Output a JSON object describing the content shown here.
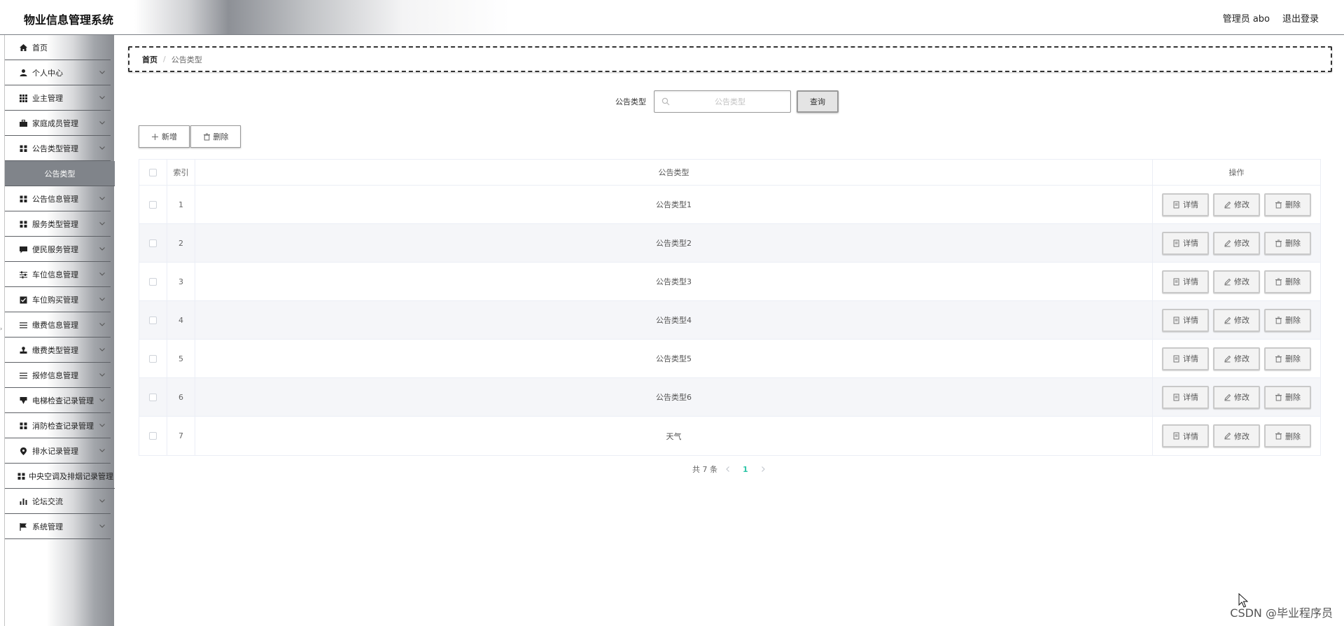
{
  "header": {
    "title": "物业信息管理系统",
    "user": "管理员 abo",
    "logout": "退出登录"
  },
  "sidebar": {
    "items": [
      {
        "label": "首页",
        "icon": "home-icon",
        "expandable": false
      },
      {
        "label": "个人中心",
        "icon": "user-icon",
        "expandable": true
      },
      {
        "label": "业主管理",
        "icon": "grid-icon",
        "expandable": true
      },
      {
        "label": "家庭成员管理",
        "icon": "briefcase-icon",
        "expandable": true
      },
      {
        "label": "公告类型管理",
        "icon": "apps-icon",
        "expandable": true
      },
      {
        "label": "公告信息管理",
        "icon": "apps-icon",
        "expandable": true
      },
      {
        "label": "服务类型管理",
        "icon": "apps-icon",
        "expandable": true
      },
      {
        "label": "便民服务管理",
        "icon": "chat-icon",
        "expandable": true
      },
      {
        "label": "车位信息管理",
        "icon": "sliders-icon",
        "expandable": true
      },
      {
        "label": "车位购买管理",
        "icon": "checkbox-icon",
        "expandable": true
      },
      {
        "label": "缴费信息管理",
        "icon": "list-icon",
        "expandable": true
      },
      {
        "label": "缴费类型管理",
        "icon": "stamp-icon",
        "expandable": true
      },
      {
        "label": "报修信息管理",
        "icon": "list-icon",
        "expandable": true
      },
      {
        "label": "电梯检查记录管理",
        "icon": "elevator-icon",
        "expandable": true
      },
      {
        "label": "消防检查记录管理",
        "icon": "apps-icon",
        "expandable": true
      },
      {
        "label": "排水记录管理",
        "icon": "location-icon",
        "expandable": true
      },
      {
        "label": "中央空调及排烟记录管理",
        "icon": "apps-icon",
        "expandable": false
      },
      {
        "label": "论坛交流",
        "icon": "bar-chart-icon",
        "expandable": true
      },
      {
        "label": "系统管理",
        "icon": "flag-icon",
        "expandable": true
      }
    ],
    "active_submenu": "公告类型"
  },
  "breadcrumb": {
    "home": "首页",
    "separator": "/",
    "current": "公告类型"
  },
  "search": {
    "label": "公告类型",
    "placeholder": "公告类型",
    "value": "",
    "button": "查询"
  },
  "toolbar": {
    "add": "新增",
    "delete": "删除"
  },
  "table": {
    "columns": [
      "索引",
      "公告类型",
      "操作"
    ],
    "rows": [
      {
        "index": "1",
        "type": "公告类型1"
      },
      {
        "index": "2",
        "type": "公告类型2"
      },
      {
        "index": "3",
        "type": "公告类型3"
      },
      {
        "index": "4",
        "type": "公告类型4"
      },
      {
        "index": "5",
        "type": "公告类型5"
      },
      {
        "index": "6",
        "type": "公告类型6"
      },
      {
        "index": "7",
        "type": "天气"
      }
    ],
    "actions": {
      "detail": "详情",
      "edit": "修改",
      "delete": "删除"
    }
  },
  "pagination": {
    "total": "共 7 条",
    "current_page": "1"
  },
  "watermark": "CSDN @毕业程序员",
  "colors": {
    "accent": "#2cc5a7",
    "active_menu": "#80848a",
    "stripe": "#f5f6f9"
  }
}
